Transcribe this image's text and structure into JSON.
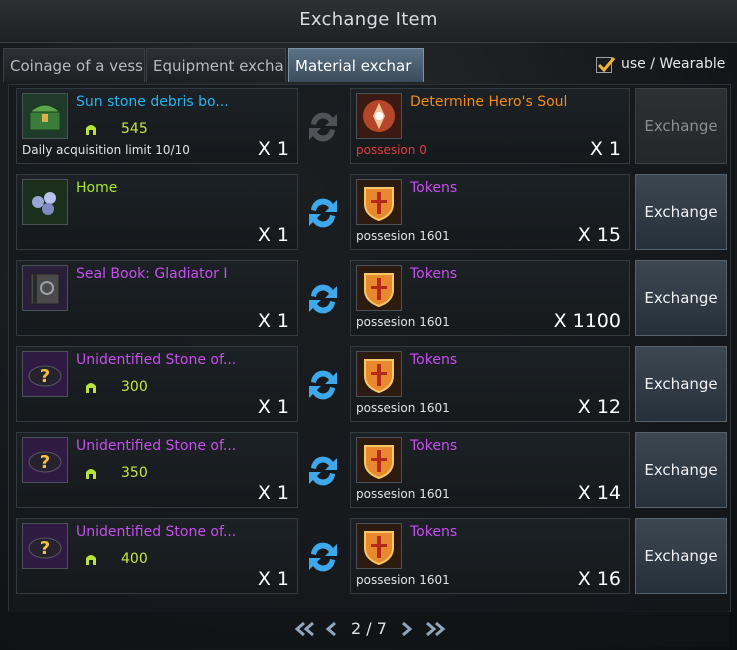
{
  "window": {
    "title": "Exchange Item"
  },
  "tabs": [
    {
      "label": "Coinage of a vess",
      "active": false
    },
    {
      "label": "Equipment excha",
      "active": false
    },
    {
      "label": "Material exchar",
      "active": true
    }
  ],
  "filter": {
    "label": "use / Wearable",
    "checked": true
  },
  "rows": [
    {
      "cost": {
        "name": "Sun stone debris bo...",
        "name_color": "#25b5f0",
        "icon": "treasure-chest-icon",
        "level": "545",
        "limit_text": "Daily acquisition limit 10/10",
        "qty": "X 1"
      },
      "reward": {
        "name": "Determine Hero's Soul",
        "name_color": "#f08b1c",
        "icon": "hero-soul-icon",
        "possession": "possesion 0",
        "qty": "X 1"
      },
      "button": "Exchange",
      "enabled": false
    },
    {
      "cost": {
        "name": "Home",
        "name_color": "#a8e831",
        "icon": "pearls-icon",
        "qty": "X 1"
      },
      "reward": {
        "name": "Tokens",
        "name_color": "#c94ef0",
        "icon": "token-shield-icon",
        "possession": "possesion 1601",
        "qty": "X 15"
      },
      "button": "Exchange",
      "enabled": true
    },
    {
      "cost": {
        "name": "Seal Book: Gladiator I",
        "name_color": "#c94ef0",
        "icon": "seal-book-icon",
        "qty": "X 1"
      },
      "reward": {
        "name": "Tokens",
        "name_color": "#c94ef0",
        "icon": "token-shield-icon",
        "possession": "possesion 1601",
        "qty": "X 1100"
      },
      "button": "Exchange",
      "enabled": true
    },
    {
      "cost": {
        "name": "Unidentified Stone of...",
        "name_color": "#c94ef0",
        "icon": "unidentified-stone-icon",
        "level": "300",
        "qty": "X 1"
      },
      "reward": {
        "name": "Tokens",
        "name_color": "#c94ef0",
        "icon": "token-shield-icon",
        "possession": "possesion 1601",
        "qty": "X 12"
      },
      "button": "Exchange",
      "enabled": true
    },
    {
      "cost": {
        "name": "Unidentified Stone of...",
        "name_color": "#c94ef0",
        "icon": "unidentified-stone-icon",
        "level": "350",
        "qty": "X 1"
      },
      "reward": {
        "name": "Tokens",
        "name_color": "#c94ef0",
        "icon": "token-shield-icon",
        "possession": "possesion 1601",
        "qty": "X 14"
      },
      "button": "Exchange",
      "enabled": true
    },
    {
      "cost": {
        "name": "Unidentified Stone of...",
        "name_color": "#c94ef0",
        "icon": "unidentified-stone-icon",
        "level": "400",
        "qty": "X 1"
      },
      "reward": {
        "name": "Tokens",
        "name_color": "#c94ef0",
        "icon": "token-shield-icon",
        "possession": "possesion 1601",
        "qty": "X 16"
      },
      "button": "Exchange",
      "enabled": true
    }
  ],
  "pager": {
    "current": 2,
    "total": 7,
    "text": "2 / 7"
  }
}
